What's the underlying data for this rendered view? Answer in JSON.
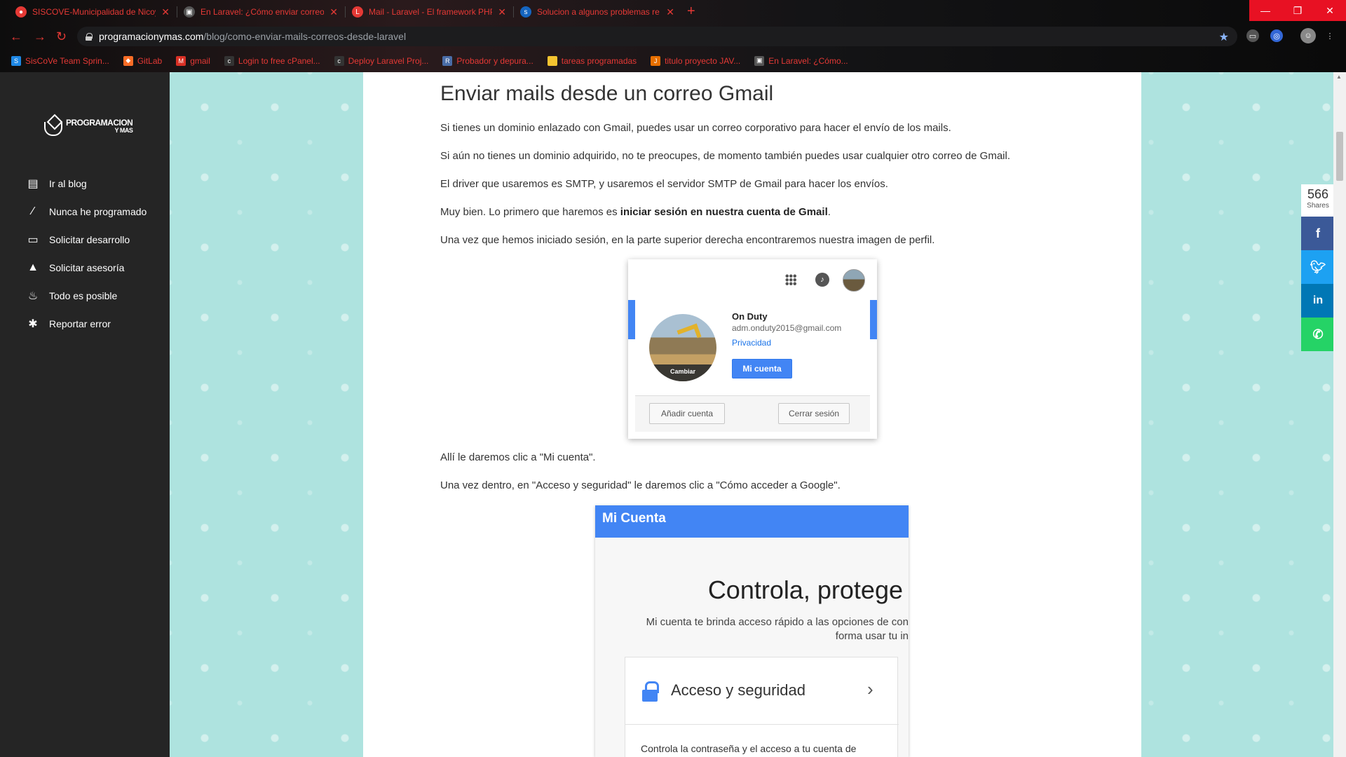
{
  "browser": {
    "tabs": [
      {
        "title": "SISCOVE-Municipalidad de Nicoya",
        "icon": "siscove-icon",
        "color": "#e53935"
      },
      {
        "title": "En Laravel: ¿Cómo enviar correos",
        "icon": "page-icon",
        "color": "#555555"
      },
      {
        "title": "Mail - Laravel - El framework PHP",
        "icon": "laravel-icon",
        "color": "#e53935"
      },
      {
        "title": "Solucion a algunos problemas re",
        "icon": "symfony-icon",
        "color": "#1565c0"
      }
    ],
    "url_host": "programacionymas.com",
    "url_path": "/blog/como-enviar-mails-correos-desde-laravel",
    "bookmarks": [
      {
        "label": "SisCoVe Team Sprin...",
        "icon": "scrum-icon",
        "color": "#1e88e5"
      },
      {
        "label": "GitLab",
        "icon": "gitlab-icon",
        "color": "#fc6d26"
      },
      {
        "label": "gmail",
        "icon": "gmail-icon",
        "color": "#d93025"
      },
      {
        "label": "Login to free cPanel...",
        "icon": "cpanel-icon",
        "color": "#333333"
      },
      {
        "label": "Deploy Laravel Proj...",
        "icon": "cpanel-icon",
        "color": "#333333"
      },
      {
        "label": "Probador y depura...",
        "icon": "regex-icon",
        "color": "#4a6da7"
      },
      {
        "label": "tareas programadas",
        "icon": "folder-icon",
        "color": "#f4c430"
      },
      {
        "label": "titulo proyecto JAV...",
        "icon": "java-icon",
        "color": "#e76f00"
      },
      {
        "label": "En Laravel: ¿Cómo...",
        "icon": "page-icon",
        "color": "#555555"
      }
    ]
  },
  "sidebar": {
    "logo_text": "PROGRAMACION",
    "logo_sub": "Y MAS",
    "items": [
      {
        "label": "Ir al blog",
        "icon": "book-icon"
      },
      {
        "label": "Nunca he programado",
        "icon": "magic-wand-icon"
      },
      {
        "label": "Solicitar desarrollo",
        "icon": "laptop-icon"
      },
      {
        "label": "Solicitar asesoría",
        "icon": "graduation-cap-icon"
      },
      {
        "label": "Todo es posible",
        "icon": "fire-icon"
      },
      {
        "label": "Reportar error",
        "icon": "bug-icon"
      }
    ]
  },
  "article": {
    "heading": "Enviar mails desde un correo Gmail",
    "p1": "Si tienes un dominio enlazado con Gmail, puedes usar un correo corporativo para hacer el envío de los mails.",
    "p2": "Si aún no tienes un dominio adquirido, no te preocupes, de momento también puedes usar cualquier otro correo de Gmail.",
    "p3": "El driver que usaremos es SMTP, y usaremos el servidor SMTP de Gmail para hacer los envíos.",
    "p4_pre": "Muy bien. Lo primero que haremos es ",
    "p4_bold": "iniciar sesión en nuestra cuenta de Gmail",
    "p4_post": ".",
    "p5": "Una vez que hemos iniciado sesión, en la parte superior derecha encontraremos nuestra imagen de perfil.",
    "p6": "Allí le daremos clic a \"Mi cuenta\".",
    "p7": "Una vez dentro, en \"Acceso y seguridad\" le daremos clic a \"Cómo acceder a Google\"."
  },
  "google_popup": {
    "name": "On Duty",
    "email": "adm.onduty2015@gmail.com",
    "privacy": "Privacidad",
    "change": "Cambiar",
    "my_account": "Mi cuenta",
    "add_account": "Añadir cuenta",
    "sign_out": "Cerrar sesión"
  },
  "mi_cuenta": {
    "header": "Mi Cuenta",
    "title": "Controla, protege",
    "sub1": "Mi cuenta te brinda acceso rápido a las opciones de con",
    "sub2": "forma usar tu in",
    "section": "Acceso y seguridad",
    "desc": "Controla la contraseña y el acceso a tu cuenta de Google."
  },
  "share": {
    "count": "566",
    "label": "Shares",
    "buttons": [
      {
        "name": "facebook",
        "glyph": "f",
        "color": "#3b5998"
      },
      {
        "name": "twitter",
        "glyph": "t",
        "color": "#1da1f2"
      },
      {
        "name": "linkedin",
        "glyph": "in",
        "color": "#0077b5"
      },
      {
        "name": "whatsapp",
        "glyph": "w",
        "color": "#25d366"
      }
    ]
  }
}
